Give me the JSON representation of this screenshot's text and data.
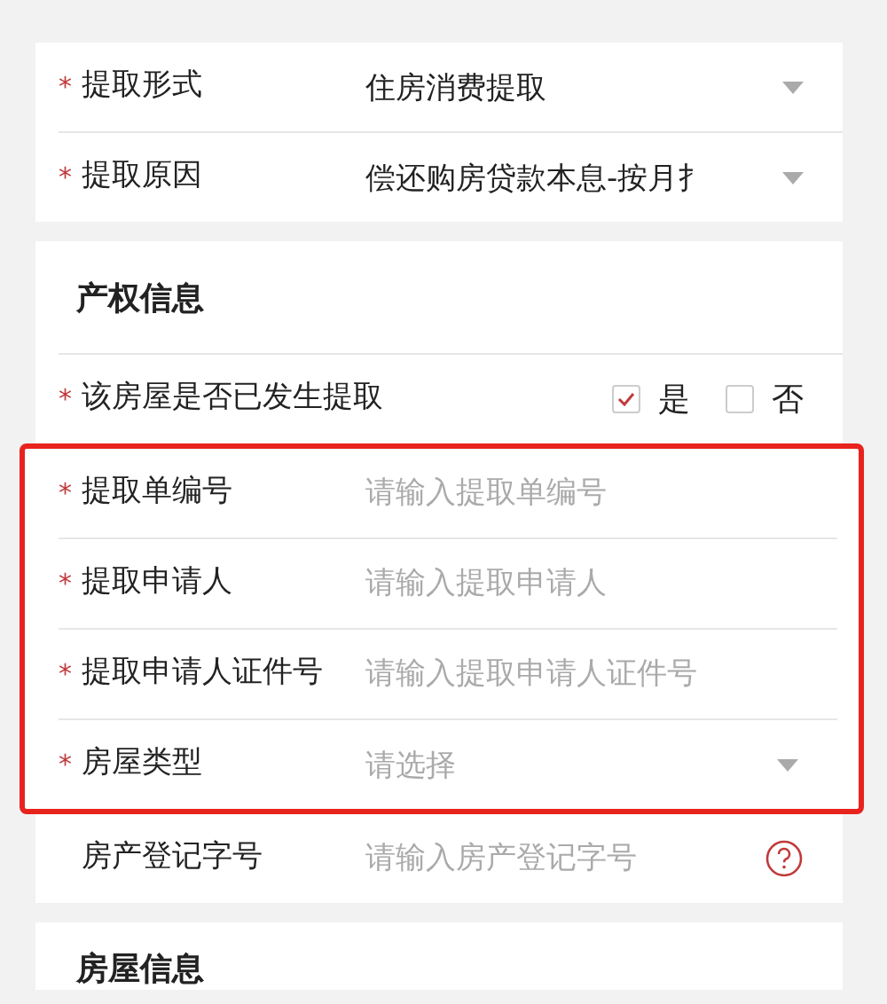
{
  "sections": [
    {
      "rows": [
        {
          "kind": "select",
          "mark": "*",
          "highlighted": false,
          "label": "提取形式",
          "value": "住房消费提取"
        },
        {
          "kind": "select",
          "mark": "*",
          "highlighted": false,
          "label": "提取原因",
          "value": "偿还购房贷款本息-按月扌"
        }
      ]
    },
    {
      "title": "产权信息",
      "rows": [
        {
          "kind": "checks",
          "mark": "*",
          "highlighted": false,
          "label": "该房屋是否已发生提取",
          "options": [
            {
              "label": "是",
              "checked": true
            },
            {
              "label": "否",
              "checked": false
            }
          ]
        },
        {
          "kind": "input",
          "mark": "*",
          "highlighted": true,
          "label": "提取单编号",
          "placeholder": "请输入提取单编号"
        },
        {
          "kind": "input",
          "mark": "*",
          "highlighted": true,
          "label": "提取申请人",
          "placeholder": "请输入提取申请人"
        },
        {
          "kind": "input",
          "mark": "*",
          "highlighted": true,
          "label": "提取申请人证件号",
          "placeholder": "请输入提取申请人证件号"
        },
        {
          "kind": "select",
          "mark": "*",
          "highlighted": true,
          "label": "房屋类型",
          "placeholder": "请选择"
        },
        {
          "kind": "help",
          "highlighted": false,
          "label": "房产登记字号",
          "placeholder": "请输入房产登记字号"
        }
      ]
    },
    {
      "title": "房屋信息"
    }
  ]
}
